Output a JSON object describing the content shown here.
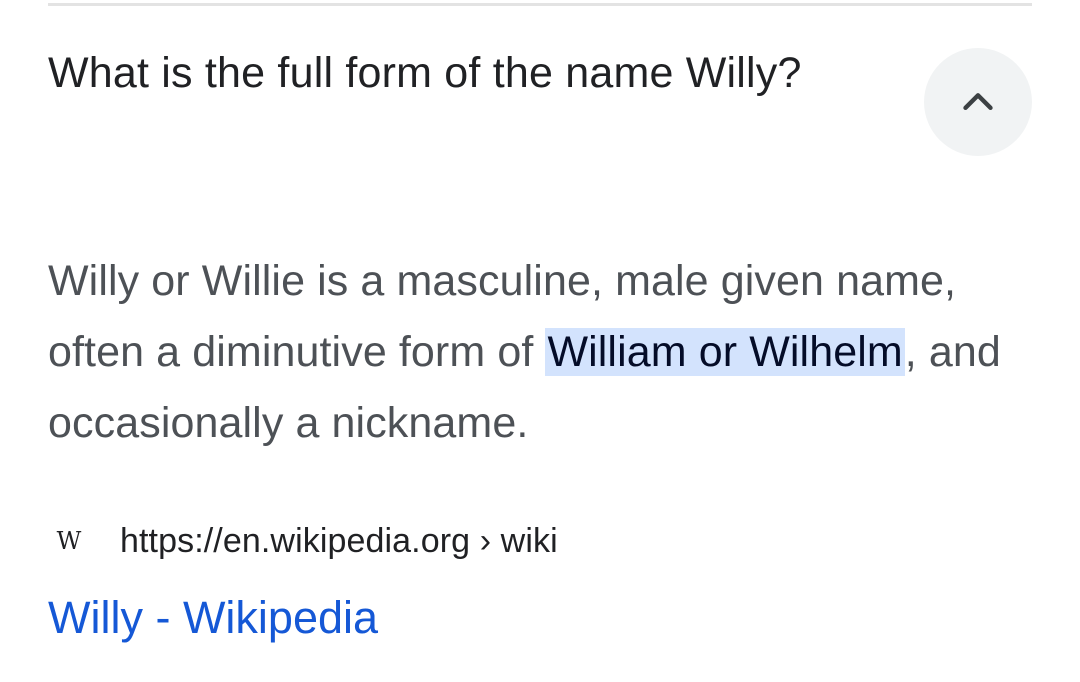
{
  "question": "What is the full form of the name Willy?",
  "answer": {
    "before": "Willy or Willie is a masculine, male given name, often a diminutive form of ",
    "highlight": "William or Wilhelm",
    "after": ", and occasionally a nickname."
  },
  "source": {
    "favicon": "W",
    "url": "https://en.wikipedia.org › wiki"
  },
  "result_title": "Willy - Wikipedia",
  "icons": {
    "collapse": "chevron-up-icon"
  },
  "colors": {
    "highlight_bg": "#d3e3fd",
    "link": "#1558d6",
    "text": "#4d5156"
  }
}
